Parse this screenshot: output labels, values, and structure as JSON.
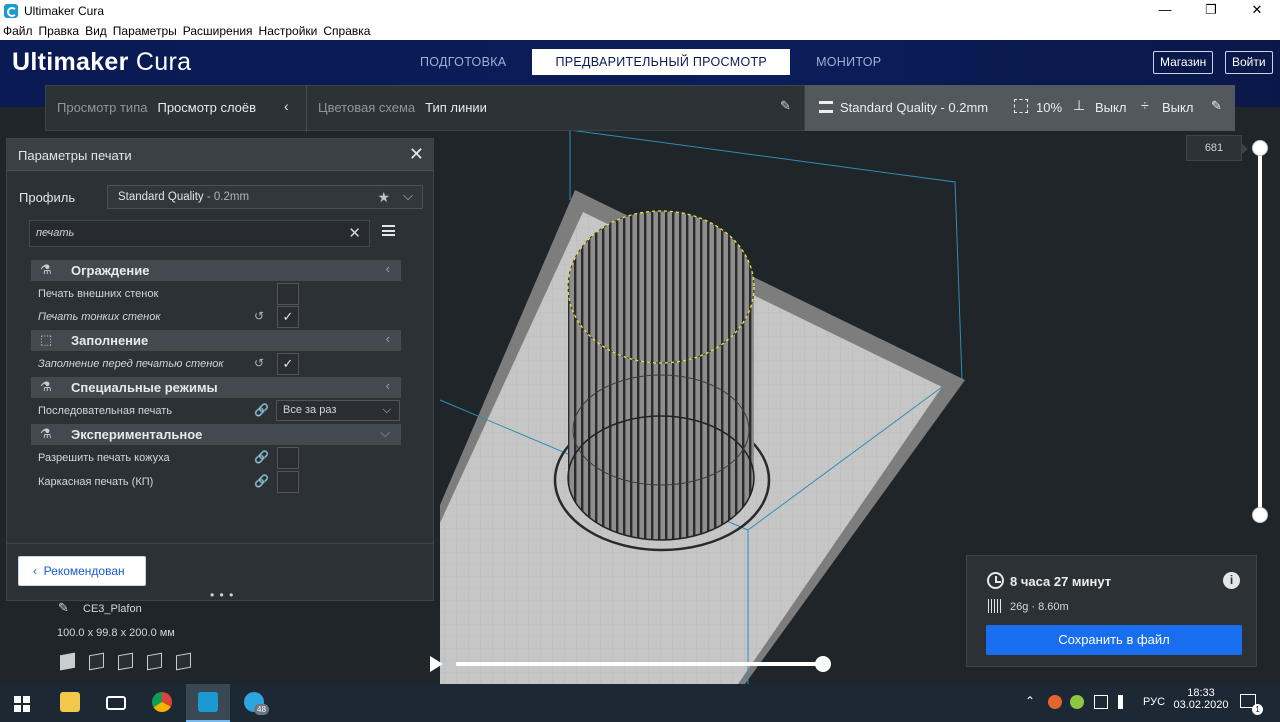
{
  "window": {
    "title": "Ultimaker Cura",
    "controls": [
      "—",
      "❐",
      "✕"
    ]
  },
  "menu": [
    "Файл",
    "Правка",
    "Вид",
    "Параметры",
    "Расширения",
    "Настройки",
    "Справка"
  ],
  "header": {
    "logo_bold": "Ultimaker",
    "logo_light": "Cura",
    "tabs": [
      {
        "label": "ПОДГОТОВКА",
        "active": false
      },
      {
        "label": "ПРЕДВАРИТЕЛЬНЫЙ ПРОСМОТР",
        "active": true
      },
      {
        "label": "МОНИТОР",
        "active": false
      }
    ],
    "marketplace_label": "Магазин",
    "login_label": "Войти"
  },
  "viewbar": {
    "view_type_label": "Просмотр типа",
    "view_type_value": "Просмотр слоёв",
    "color_scheme_label": "Цветовая схема",
    "color_scheme_value": "Тип линии"
  },
  "quality": {
    "profile": "Standard Quality - 0.2mm",
    "infill": "10%",
    "support": "Выкл",
    "adhesion": "Выкл"
  },
  "panel": {
    "title": "Параметры печати",
    "profile_label": "Профиль",
    "profile_name": "Standard Quality",
    "profile_suffix": " - 0.2mm",
    "search_value": "печать",
    "categories": [
      {
        "name": "Ограждение",
        "icon": "shell-icon"
      },
      {
        "name": "Заполнение",
        "icon": "infill-icon"
      },
      {
        "name": "Специальные режимы",
        "icon": "special-modes-icon"
      },
      {
        "name": "Экспериментальное",
        "icon": "experimental-icon"
      }
    ],
    "settings": {
      "print_outer_walls": {
        "label": "Печать внешних стенок",
        "checked": false
      },
      "print_thin_walls": {
        "label": "Печать тонких стенок",
        "checked": true
      },
      "infill_before_walls": {
        "label": "Заполнение перед печатью стенок",
        "checked": true
      },
      "print_sequence": {
        "label": "Последовательная печать",
        "value": "Все за раз"
      },
      "enable_skin_print": {
        "label": "Разрешить печать кожуха",
        "checked": false
      },
      "wire_printing": {
        "label": "Каркасная печать (КП)",
        "checked": false
      }
    },
    "recommended_label": "Рекомендован"
  },
  "object": {
    "name": "CE3_Plafon",
    "dimensions": "100.0 x 99.8 x 200.0 мм"
  },
  "layer": {
    "current": "681"
  },
  "estimate": {
    "time": "8 часа 27 минут",
    "material": "26g · 8.60m",
    "save_label": "Сохранить в файл"
  },
  "taskbar": {
    "language": "РУС",
    "time": "18:33",
    "date": "03.02.2020",
    "telegram_badge": "48",
    "notification_count": "1"
  },
  "colors": {
    "header_bg": "#0a1a53",
    "accent": "#196ef0",
    "panel_bg": "#2c3135",
    "build_plate": "#c6c6c6"
  }
}
